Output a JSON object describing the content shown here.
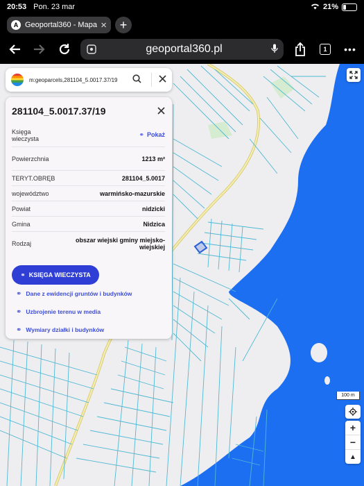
{
  "status": {
    "time": "20:53",
    "date": "Pon. 23 mar",
    "battery": "21%",
    "battery_level": 0.21
  },
  "browser": {
    "tab_favicon": "A",
    "tab_title": "Geoportal360 - Mapa I",
    "new_tab": "+",
    "url": "geoportal360.pl",
    "tab_count": "1",
    "icons": [
      "back-arrow-icon",
      "forward-arrow-icon",
      "reload-icon",
      "site-settings-icon",
      "microphone-icon",
      "share-icon",
      "tabs-icon",
      "more-icon"
    ]
  },
  "search": {
    "query": "m:geoparcels,281104_5.0017.37/19"
  },
  "parcel": {
    "title": "281104_5.0017.37/19",
    "rows": [
      {
        "label": "Księga\nwieczysta",
        "link": "Pokaż"
      },
      {
        "label": "Powierzchnia",
        "value": "1213 m²"
      },
      {
        "label": "TERYT.OBRĘB",
        "value": "281104_5.0017"
      },
      {
        "label": "województwo",
        "value": "warmińsko-mazurskie"
      },
      {
        "label": "Powiat",
        "value": "nidzicki"
      },
      {
        "label": "Gmina",
        "value": "Nidzica"
      },
      {
        "label": "Rodzaj",
        "value": "obszar wiejski gminy miejsko-wiejskiej"
      }
    ],
    "primary_button": "KSIĘGA WIECZYSTA",
    "links": [
      "Dane z ewidencji gruntów i budynków",
      "Uzbrojenie terenu w media",
      "Wymiary działki i budynków"
    ]
  },
  "map": {
    "scale": "100 m",
    "zoom_in": "+",
    "zoom_out": "−",
    "compass": "▲",
    "colors": {
      "land": "#eeeef0",
      "water": "#1d6ff2",
      "parcel_lines": "#4fb8d4",
      "road": "#e8dc8a",
      "selected": "#2c5fd8",
      "forest": "#d5ecd0"
    }
  }
}
